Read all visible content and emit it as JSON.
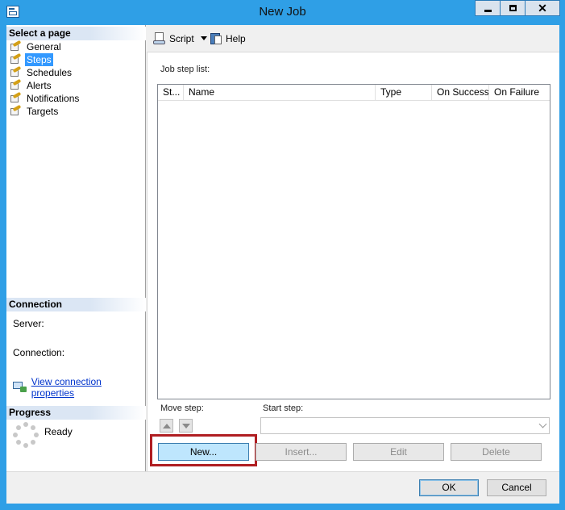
{
  "window": {
    "title": "New Job"
  },
  "left_pane": {
    "select_page_heading": "Select a page",
    "pages": [
      {
        "label": "General",
        "selected": false
      },
      {
        "label": "Steps",
        "selected": true
      },
      {
        "label": "Schedules",
        "selected": false
      },
      {
        "label": "Alerts",
        "selected": false
      },
      {
        "label": "Notifications",
        "selected": false
      },
      {
        "label": "Targets",
        "selected": false
      }
    ],
    "connection_heading": "Connection",
    "server_label": "Server:",
    "connection_label": "Connection:",
    "view_connection_link": "View connection properties",
    "progress_heading": "Progress",
    "progress_status": "Ready"
  },
  "toolbar": {
    "script_label": "Script",
    "help_label": "Help"
  },
  "steps": {
    "job_step_list_label": "Job step list:",
    "columns": [
      "St...",
      "Name",
      "Type",
      "On Success",
      "On Failure"
    ],
    "rows": [],
    "move_step_label": "Move step:",
    "start_step_label": "Start step:",
    "start_step_value": "",
    "new_button": "New...",
    "insert_button": "Insert...",
    "edit_button": "Edit",
    "delete_button": "Delete"
  },
  "footer": {
    "ok_button": "OK",
    "cancel_button": "Cancel"
  },
  "colors": {
    "title_bar": "#2f9fe6",
    "selection": "#3399ff",
    "highlight_box": "#b01e22",
    "link": "#0033cc"
  }
}
